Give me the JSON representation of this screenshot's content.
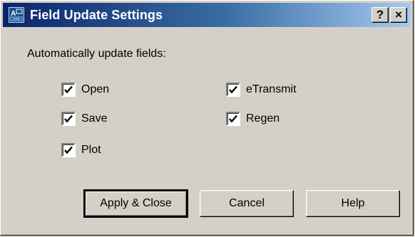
{
  "window": {
    "title": "Field Update Settings",
    "help_button": "?",
    "close_button": "×"
  },
  "group": {
    "label": "Automatically update fields:"
  },
  "options": [
    {
      "label": "Open",
      "checked": true
    },
    {
      "label": "eTransmit",
      "checked": true
    },
    {
      "label": "Save",
      "checked": true
    },
    {
      "label": "Regen",
      "checked": true
    },
    {
      "label": "Plot",
      "checked": true
    }
  ],
  "buttons": {
    "apply_close": "Apply & Close",
    "cancel": "Cancel",
    "help": "Help"
  },
  "colors": {
    "title_start": "#0a246a",
    "title_end": "#a6caf0",
    "face": "#d4d0c8"
  }
}
